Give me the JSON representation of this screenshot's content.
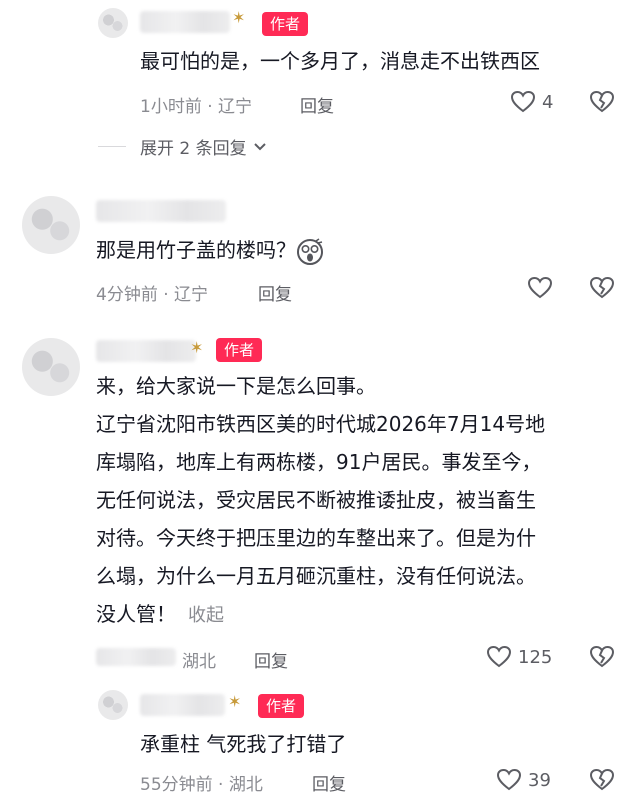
{
  "comments": [
    {
      "author_badge": "作者",
      "text": "最可怕的是，一个多月了，消息走不出铁西区",
      "meta": "1小时前 · 辽宁",
      "reply_label": "回复",
      "likes": "4",
      "expand_label": "展开 2 条回复"
    },
    {
      "text": "那是用竹子盖的楼吗？",
      "meta": "4分钟前 · 辽宁",
      "reply_label": "回复"
    },
    {
      "author_badge": "作者",
      "lines": [
        "来，给大家说一下是怎么回事。",
        "辽宁省沈阳市铁西区美的时代城2026年7月14号地",
        "库塌陷，地库上有两栋楼，91户居民。事发至今，",
        "无任何说法，受灾居民不断被推诿扯皮，被当畜生",
        "对待。今天终于把压里边的车整出来了。但是为什",
        "么塌，为什么一月五月砸沉重柱，没有任何说法。",
        "没人管！"
      ],
      "fold_label": "收起",
      "meta": "湖北",
      "reply_label": "回复",
      "likes": "125"
    },
    {
      "author_badge": "作者",
      "text": "承重柱 气死我了打错了",
      "meta": "55分钟前 · 湖北",
      "reply_label": "回复",
      "likes": "39"
    }
  ],
  "icons": {
    "like": "heart-outline-icon",
    "dislike": "broken-heart-icon",
    "expand": "chevron-down-icon",
    "emoji": "shocked-face-emoji",
    "badge_decoration": "scorpion-icon"
  }
}
